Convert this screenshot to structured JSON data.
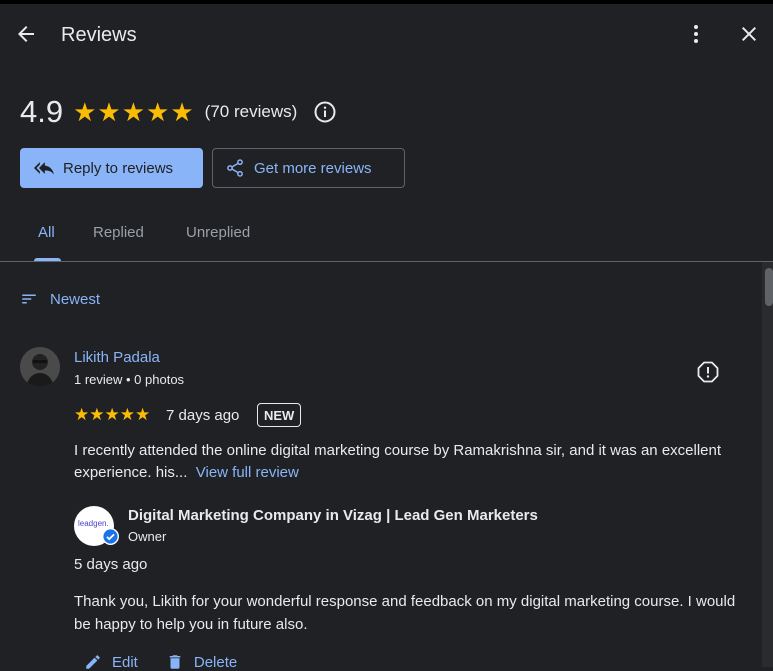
{
  "header": {
    "title": "Reviews"
  },
  "summary": {
    "rating": "4.9",
    "stars": 5,
    "count_text": "(70 reviews)"
  },
  "buttons": {
    "reply": "Reply to reviews",
    "get_more": "Get more reviews"
  },
  "tabs": [
    {
      "label": "All",
      "active": true
    },
    {
      "label": "Replied",
      "active": false
    },
    {
      "label": "Unreplied",
      "active": false
    }
  ],
  "sort": {
    "label": "Newest"
  },
  "review": {
    "author": "Likith Padala",
    "meta": "1 review • 0 photos",
    "stars": 5,
    "date": "7 days ago",
    "badge": "NEW",
    "text": "I recently attended the online digital marketing course by Ramakrishna sir, and it was an excellent experience. his...",
    "view_full": "View full review"
  },
  "owner_reply": {
    "logo_text": "leadgen.",
    "name": "Digital Marketing Company in Vizag | Lead Gen Marketers",
    "role": "Owner",
    "date": "5 days ago",
    "text": "Thank you, Likith for your wonderful response and feedback on my digital marketing course. I would be happy to help you in future also.",
    "edit": "Edit",
    "delete": "Delete"
  },
  "colors": {
    "accent": "#8ab4f8",
    "star": "#fbbc04",
    "background": "#202124"
  }
}
